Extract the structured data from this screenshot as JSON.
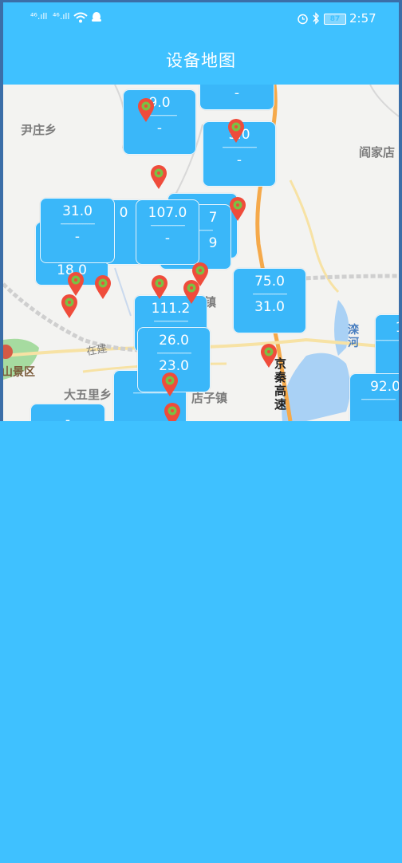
{
  "status_bar": {
    "signal_left": "⁴⁶.ıll",
    "signal_right": "⁴⁶.ıll",
    "battery": "87",
    "time": "2:57"
  },
  "header": {
    "title": "设备地图"
  },
  "map": {
    "places": [
      "尹庄乡",
      "阎家店",
      "大五里乡",
      "山景区",
      "京秦高速",
      "滦河",
      "店子镇",
      "镇",
      "在建"
    ],
    "callouts": [
      {
        "top": "9.0",
        "bottom": "-"
      },
      {
        "top": "-",
        "bottom": ""
      },
      {
        "top": "5.0",
        "bottom": "-"
      },
      {
        "top": "31.0",
        "bottom": "-"
      },
      {
        "top": "18.0",
        "bottom": ""
      },
      {
        "top": "107.0",
        "bottom": "-"
      },
      {
        "top": "7",
        "bottom": "9"
      },
      {
        "top": "75.0",
        "bottom": "31.0"
      },
      {
        "top": "111.2",
        "bottom": ""
      },
      {
        "top": "26.0",
        "bottom": "23.0"
      },
      {
        "top": "92.0",
        "bottom": ""
      },
      {
        "top": "1",
        "bottom": ""
      },
      {
        "top": "-",
        "bottom": ""
      },
      {
        "top": "0",
        "bottom": ""
      }
    ],
    "dashes": "-------------------",
    "marker_color": "#ef4c3b",
    "marker_dot_color": "#7bc043"
  },
  "colors": {
    "accent": "#3fc1ff",
    "callout": "#3ab7f9"
  }
}
